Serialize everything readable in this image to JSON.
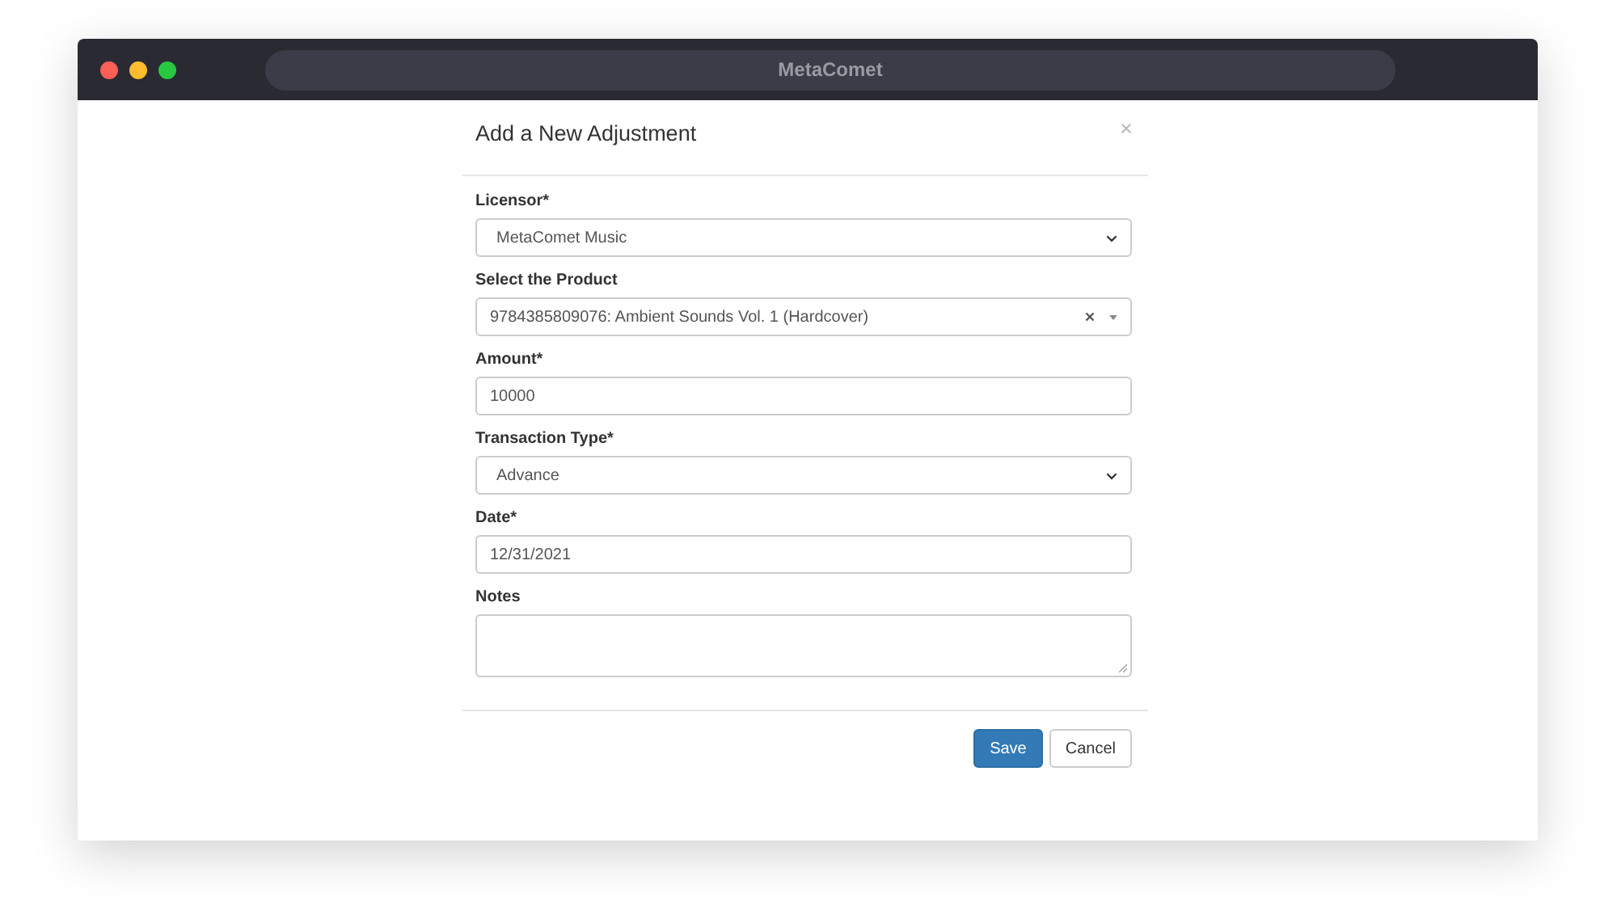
{
  "window": {
    "title": "MetaComet"
  },
  "dialog": {
    "title": "Add a New Adjustment",
    "fields": [
      {
        "kind": "select",
        "label": "Licensor*",
        "value": "MetaComet Music"
      },
      {
        "kind": "combo",
        "label": "Select the Product",
        "value": "9784385809076: Ambient Sounds Vol. 1 (Hardcover)"
      },
      {
        "kind": "text",
        "label": "Amount*",
        "value": "10000"
      },
      {
        "kind": "select",
        "label": "Transaction Type*",
        "value": "Advance"
      },
      {
        "kind": "text",
        "label": "Date*",
        "value": "12/31/2021"
      },
      {
        "kind": "textarea",
        "label": "Notes"
      }
    ],
    "buttons": [
      {
        "kind": "primary",
        "label": "Save"
      },
      {
        "kind": "default",
        "label": "Cancel"
      }
    ]
  }
}
